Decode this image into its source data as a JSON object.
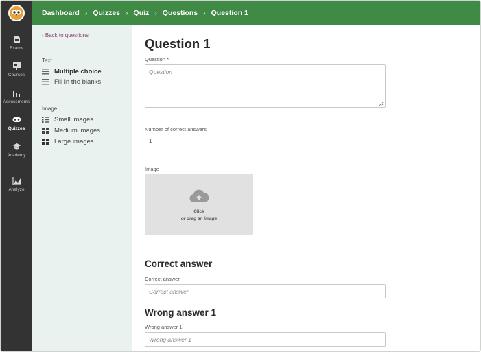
{
  "breadcrumb": [
    "Dashboard",
    "Quizzes",
    "Quiz",
    "Questions",
    "Question 1"
  ],
  "breadcrumb_separator": "›",
  "sidenav": [
    {
      "label": "Exams",
      "icon": "document-icon"
    },
    {
      "label": "Courses",
      "icon": "presentation-icon"
    },
    {
      "label": "Assessments",
      "icon": "bar-chart-icon"
    },
    {
      "label": "Quizzes",
      "icon": "gamepad-icon",
      "active": true
    },
    {
      "label": "Academy",
      "icon": "graduation-cap-icon"
    },
    {
      "label": "Analyze",
      "icon": "area-chart-icon"
    }
  ],
  "panel": {
    "back_link": "‹ Back to questions",
    "text_section": "Text",
    "text_items": [
      "Multiple choice",
      "Fill in the blanks"
    ],
    "image_section": "Image",
    "image_items": [
      "Small images",
      "Medium images",
      "Large images"
    ]
  },
  "main": {
    "title": "Question 1",
    "question_label": "Question",
    "required_mark": "*",
    "question_placeholder": "Question",
    "correct_count_label": "Number of correct answers",
    "correct_count_value": "1",
    "image_label": "Image",
    "dropzone_click": "Click",
    "dropzone_drag": "or drag an image",
    "correct_heading": "Correct answer",
    "correct_label": "Correct answer",
    "correct_placeholder": "Correct answer",
    "wrong_heading": "Wrong answer 1",
    "wrong_label": "Wrong answer 1",
    "wrong_placeholder": "Wrong answer 1"
  },
  "colors": {
    "topbar": "#3f8a45",
    "sidenav": "#333333",
    "panel": "#e9f2ee",
    "link": "#8a3f6a"
  }
}
